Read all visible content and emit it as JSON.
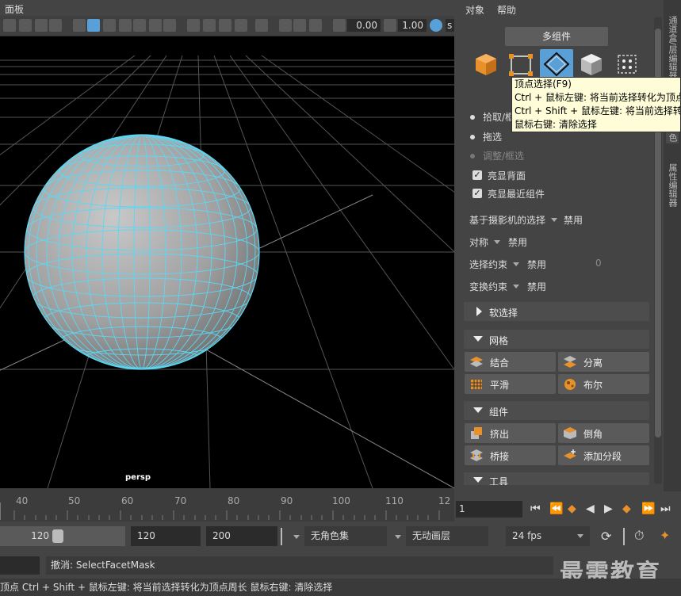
{
  "viewport": {
    "menu_label": "面板",
    "field1": "0.00",
    "field2": "1.00",
    "field3_partial": "s",
    "camera_label": "persp"
  },
  "panel": {
    "menus": [
      "对象",
      "帮助"
    ],
    "multi_component_btn": "多组件",
    "radio_pick": "拾取/框",
    "radio_drag": "拖选",
    "radio_tweak": "调整/框选",
    "chk_backface": "亮显背面",
    "chk_nearest": "亮显最近组件",
    "camera_select_label": "基于摄影机的选择",
    "camera_select_value": "禁用",
    "symmetry_label": "对称",
    "symmetry_value": "禁用",
    "constraint_label": "选择约束",
    "constraint_value": "禁用",
    "constraint_num": "0",
    "transform_label": "变换约束",
    "transform_value": "禁用",
    "soft_select": "软选择",
    "mesh_section": "网格",
    "mesh_tools": [
      "结合",
      "分离",
      "平滑",
      "布尔"
    ],
    "component_section": "组件",
    "component_tools": [
      "挤出",
      "倒角",
      "桥接",
      "添加分段"
    ],
    "tools_section": "工具",
    "side_tabs": [
      "通道盒/层编辑器",
      "色",
      "属性编辑器"
    ]
  },
  "tooltip": {
    "lines": [
      "顶点选择(F9)",
      "Ctrl + 鼠标左键: 将当前选择转化为顶点",
      "Ctrl + Shift + 鼠标左键: 将当前选择转化",
      "鼠标右键: 清除选择"
    ]
  },
  "timeline": {
    "ticks": [
      "40",
      "50",
      "60",
      "70",
      "80",
      "90",
      "100",
      "110",
      "12"
    ],
    "current_frame": "1"
  },
  "range": {
    "start_slider": "120",
    "end_field": "120",
    "max_field": "200",
    "char_set": "无角色集",
    "anim_layer": "无动画层",
    "fps": "24 fps"
  },
  "cmd": {
    "result": "撤消: SelectFacetMask",
    "watermark": "最需教育"
  },
  "help_line": "顶点 Ctrl + Shift + 鼠标左键: 将当前选择转化为顶点周长 鼠标右键: 清除选择",
  "colors": {
    "wire": "#5ad8f5",
    "highlight": "#5aa0d8",
    "icon_orange": "#e8902a"
  }
}
